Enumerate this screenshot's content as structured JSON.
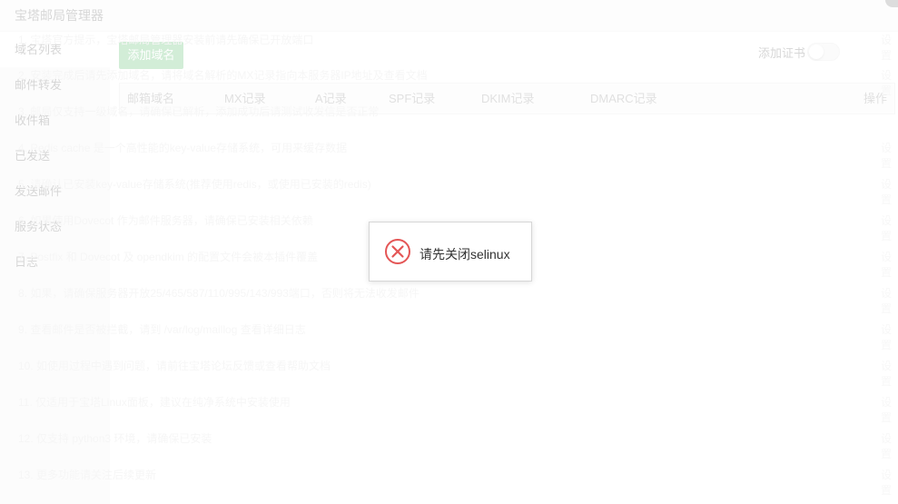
{
  "window": {
    "title": "宝塔邮局管理器"
  },
  "sidebar": {
    "items": [
      {
        "label": "域名列表",
        "active": true
      },
      {
        "label": "邮件转发"
      },
      {
        "label": "收件箱"
      },
      {
        "label": "已发送"
      },
      {
        "label": "发送邮件"
      },
      {
        "label": "服务状态"
      },
      {
        "label": "日志"
      }
    ]
  },
  "toolbar": {
    "add_domain_label": "添加域名",
    "add_cert_label": "添加证书",
    "add_cert_enabled": false
  },
  "table": {
    "headers": [
      "邮箱域名",
      "MX记录",
      "A记录",
      "SPF记录",
      "DKIM记录",
      "DMARC记录",
      "操作"
    ]
  },
  "background_text": {
    "lines": [
      "1. 宝塔官方提示，宝塔邮局管理器安装前请先确保已开放端口",
      "2. 安装完成后请先添加域名，请将域名解析的MX记录指向本服务器IP地址及查看文档",
      "3. 邮局仅支持一级域名，请确保已解析，添加成功后请测试收发信是否正常",
      "4. Redis cache 是一个高性能的key-value存储系统，可用来缓存数据",
      "5. 请确认已安装key-value存储系统(推荐使用redis，或使用已安装的redis)",
      "6. 如果使用Dovecot 作为邮件服务器，请确保已安装相关依赖",
      "7. Postfix 和 Dovecot 及 opendkim 的配置文件会被本插件覆盖",
      "8. 如果，请确保服务器开放25/465/587/110/995/143/993端口，否则将无法收发邮件",
      "9. 查看邮件是否被拦截，请到 /var/log/maillog 查看详细日志",
      "10. 如使用过程中遇到问题，请前往宝塔论坛反馈或查看帮助文档",
      "11. 仅适用于宝塔Linux面板，建议在纯净系统中安装使用",
      "12. 仅支持 python3 环境，请确保已安装",
      "13. 更多功能请关注后续更新"
    ],
    "right_label": "设置"
  },
  "toast": {
    "message": "请先关闭selinux",
    "icon": "error-circle-icon",
    "icon_color": "#e45656"
  },
  "colors": {
    "primary": "#20a53a",
    "sidebar_bg": "#f0f0f0"
  }
}
